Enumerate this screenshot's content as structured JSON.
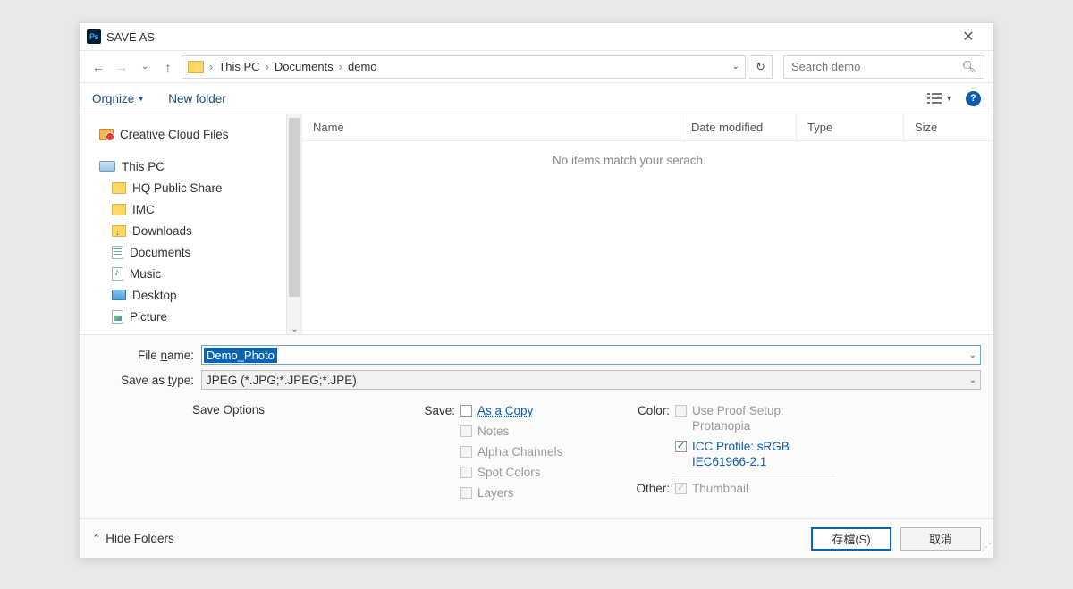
{
  "title": "SAVE AS",
  "breadcrumb": {
    "seg1": "This PC",
    "seg2": "Documents",
    "seg3": "demo"
  },
  "search": {
    "placeholder": "Search demo"
  },
  "toolbar": {
    "organize": "Orgnize",
    "newfolder": "New folder",
    "help": "?"
  },
  "tree": {
    "cc": "Creative Cloud Files",
    "thispc": "This PC",
    "hq": "HQ Public Share",
    "imc": "IMC",
    "downloads": "Downloads",
    "documents": "Documents",
    "music": "Music",
    "desktop": "Desktop",
    "picture": "Picture"
  },
  "columns": {
    "name": "Name",
    "date": "Date modified",
    "type": "Type",
    "size": "Size"
  },
  "empty_msg": "No items match your serach.",
  "filename_label_pre": "File ",
  "filename_label_ul": "n",
  "filename_label_post": "ame:",
  "filename_value": "Demo_Photo",
  "type_label_pre": "Save as ",
  "type_label_ul": "t",
  "type_label_post": "ype:",
  "type_value": "JPEG (*.JPG;*.JPEG;*.JPE)",
  "opts": {
    "header": "Save Options",
    "save_label": "Save:",
    "as_copy": "As a Copy",
    "notes": "Notes",
    "alpha": "Alpha Channels",
    "spot": "Spot Colors",
    "layers": "Layers",
    "color_label": "Color:",
    "proof": "Use Proof Setup: Protanopia",
    "icc": "ICC Profile:  sRGB IEC61966-2.1",
    "other_label": "Other:",
    "thumb": "Thumbnail"
  },
  "footer": {
    "hide": "Hide Folders",
    "save": "存檔(S)",
    "cancel": "取消"
  }
}
